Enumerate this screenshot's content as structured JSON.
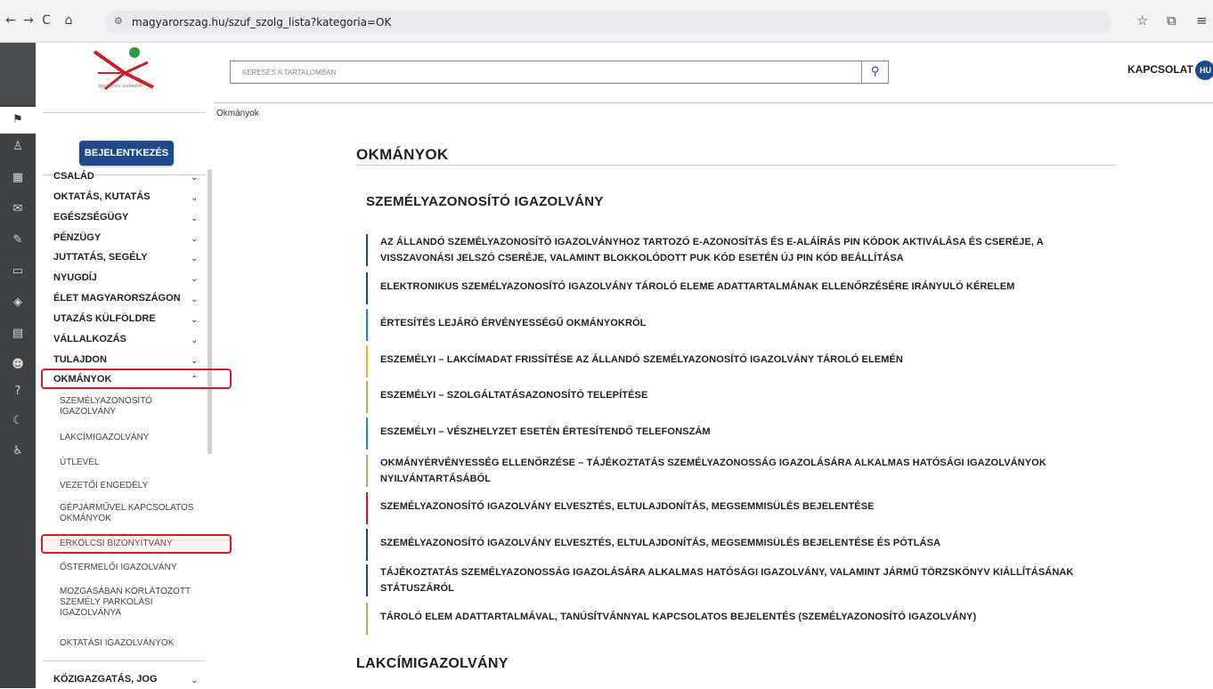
{
  "browser": {
    "url": "magyarorszag.hu/szuf_szolg_lista?kategoria=OK",
    "back": "←",
    "forward": "→",
    "reload": "C",
    "home": "⌂",
    "star": "☆",
    "ext": "⧉",
    "menu": "≡"
  },
  "logo": {
    "tagline": "ügyintézés szabadon"
  },
  "sidebar": {
    "login": "BEJELENTKEZÉS",
    "menu": [
      "CSALÁD",
      "OKTATÁS, KUTATÁS",
      "EGÉSZSÉGÜGY",
      "PÉNZÜGY",
      "JUTTATÁS, SEGÉLY",
      "NYUGDÍJ",
      "ÉLET MAGYARORSZÁGON",
      "UTAZÁS KÜLFÖLDRE",
      "VÁLLALKOZÁS",
      "TULAJDON",
      "OKMÁNYOK"
    ],
    "submenu": [
      "SZEMÉLYAZONOSÍTÓ IGAZOLVÁNY",
      "LAKCÍMIGAZOLVÁNY",
      "ÚTLEVÉL",
      "VEZETŐI ENGEDÉLY",
      "GÉPJÁRMŰVEL KAPCSOLATOS OKMÁNYOK",
      "ERKÖLCSI BIZONYÍTVÁNY",
      "ŐSTERMELŐI IGAZOLVÁNY",
      "MOZGÁSÁBAN KORLÁTOZOTT SZEMÉLY PARKOLÁSI IGAZOLVÁNYA",
      "OKTATÁSI IGAZOLVÁNYOK"
    ],
    "last_menu": "KÖZIGAZGATÁS, JOG"
  },
  "header": {
    "search_placeholder": "KERESÉS A TARTALOMBAN",
    "contact": "KAPCSOLAT",
    "lang": "HU",
    "breadcrumb": "Okmányok"
  },
  "main": {
    "title": "OKMÁNYOK",
    "section1": "SZEMÉLYAZONOSÍTÓ IGAZOLVÁNY",
    "links": [
      "AZ ÁLLANDÓ SZEMÉLYAZONOSÍTÓ IGAZOLVÁNYHOZ TARTOZÓ E-AZONOSÍTÁS ÉS E-ALÁÍRÁS PIN KÓDOK AKTIVÁLÁSA ÉS CSERÉJE, A VISSZAVONÁSI JELSZÓ CSERÉJE, VALAMINT BLOKKOLÓDOTT PUK KÓD ESETÉN ÚJ PIN KÓD BEÁLLÍTÁSA",
      "ELEKTRONIKUS SZEMÉLYAZONOSÍTÓ IGAZOLVÁNY TÁROLÓ ELEME ADATTARTALMÁNAK ELLENŐRZÉSÉRE IRÁNYULÓ KÉRELEM",
      "ÉRTESÍTÉS LEJÁRÓ ÉRVÉNYESSÉGŰ OKMÁNYOKRÓL",
      "ESZEMÉLYI – LAKCÍMADAT FRISSÍTÉSE AZ ÁLLANDÓ SZEMÉLYAZONOSÍTÓ IGAZOLVÁNY TÁROLÓ ELEMÉN",
      "ESZEMÉLYI – SZOLGÁLTATÁSAZONOSÍTÓ TELEPÍTÉSE",
      "ESZEMÉLYI – VÉSZHELYZET ESETÉN ÉRTESÍTENDŐ TELEFONSZÁM",
      "OKMÁNYÉRVÉNYESSÉG ELLENŐRZÉSE – TÁJÉKOZTATÁS SZEMÉLYAZONOSSÁG IGAZOLÁSÁRA ALKALMAS HATÓSÁGI IGAZOLVÁNYOK NYILVÁNTARTÁSÁBÓL",
      "SZEMÉLYAZONOSÍTÓ IGAZOLVÁNY ELVESZTÉS, ELTULAJDONÍTÁS, MEGSEMMISÜLÉS BEJELENTÉSE",
      "SZEMÉLYAZONOSÍTÓ IGAZOLVÁNY ELVESZTÉS, ELTULAJDONÍTÁS, MEGSEMMISÜLÉS BEJELENTÉSE ÉS PÓTLÁSA",
      "TÁJÉKOZTATÁS SZEMÉLYAZONOSSÁG IGAZOLÁSÁRA ALKALMAS HATÓSÁGI IGAZOLVÁNY, VALAMINT JÁRMŰ TÖRZSKÖNYV KIÁLLÍTÁSÁNAK STÁTUSZÁRÓL",
      "TÁROLÓ ELEM ADATTARTALMÁVAL, TANÚSÍTVÁNNYAL KAPCSOLATOS BEJELENTÉS (SZEMÉLYAZONOSÍTÓ IGAZOLVÁNY)"
    ],
    "link_colors": [
      "#1d4a8c",
      "#1d4a8c",
      "#2a88c6",
      "#e2b63a",
      "#9dbd5a",
      "#2a8ab0",
      "#9dbd5a",
      "#b5202e",
      "#1d4a8c",
      "#1d4a8c",
      "#9dbd5a"
    ],
    "section2": "LAKCÍMIGAZOLVÁNY"
  }
}
